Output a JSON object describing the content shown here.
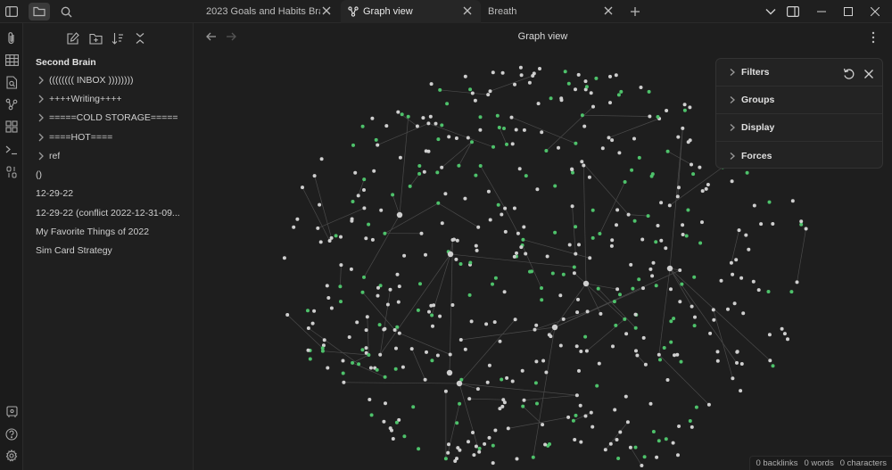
{
  "tabs": [
    {
      "label": "2023 Goals and Habits Bra...",
      "active": false
    },
    {
      "label": "Graph view",
      "active": true
    },
    {
      "label": "Breath",
      "active": false
    }
  ],
  "sidebar": {
    "vault_name": "Second Brain",
    "items": [
      {
        "label": "(((((((( INBOX ))))))))",
        "type": "folder"
      },
      {
        "label": "++++Writing++++",
        "type": "folder"
      },
      {
        "label": "=====COLD STORAGE=====",
        "type": "folder"
      },
      {
        "label": "====HOT====",
        "type": "folder"
      },
      {
        "label": "ref",
        "type": "folder"
      },
      {
        "label": "()",
        "type": "file"
      },
      {
        "label": "12-29-22",
        "type": "file"
      },
      {
        "label": "12-29-22 (conflict 2022-12-31-09...",
        "type": "file"
      },
      {
        "label": "My Favorite Things of 2022",
        "type": "file"
      },
      {
        "label": "Sim Card Strategy",
        "type": "file"
      }
    ]
  },
  "view": {
    "title": "Graph view"
  },
  "graph_panel": {
    "sections": [
      "Filters",
      "Groups",
      "Display",
      "Forces"
    ]
  },
  "statusbar": {
    "backlinks": "0 backlinks",
    "words": "0 words",
    "characters": "0 characters"
  },
  "colors": {
    "node_default": "#cfcfcf",
    "node_tag": "#4ec26b",
    "edge": "#4a4a4a",
    "background": "#1e1e1e"
  }
}
